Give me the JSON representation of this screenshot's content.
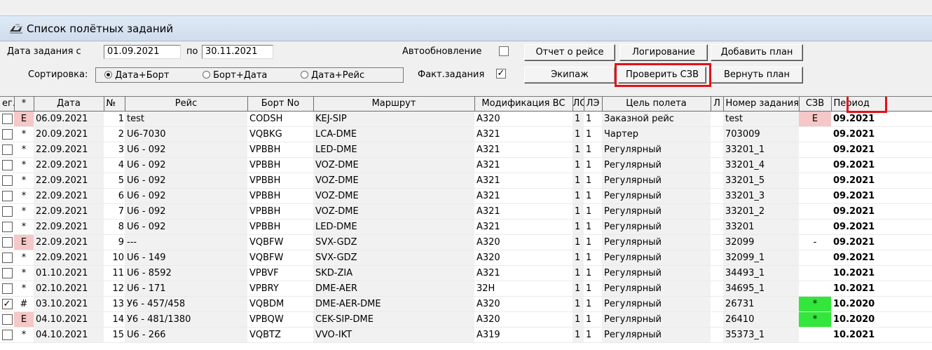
{
  "window": {
    "title": "Список полётных заданий"
  },
  "filters": {
    "date_from_label": "Дата задания с",
    "date_from": "01.09.2021",
    "date_to_label": "по",
    "date_to": "30.11.2021",
    "sort_label": "Сортировка:",
    "sort_options": [
      "Дата+Борт",
      "Борт+Дата",
      "Дата+Рейс"
    ],
    "sort_selected": "Дата+Борт",
    "autoupdate_label": "Автообновление",
    "autoupdate_checked": false,
    "fact_label": "Факт.задания",
    "fact_checked": true,
    "fact_mark": "✓"
  },
  "buttons": {
    "report": "Отчет о рейсе",
    "logging": "Логирование",
    "add_plan": "Добавить план",
    "crew": "Экипаж",
    "check_szv": "Проверить СЗВ",
    "return_plan": "Вернуть план"
  },
  "table": {
    "columns": [
      "ег.",
      "*",
      "Дата",
      "№",
      "Рейс",
      "Борт No",
      "Маршрут",
      "Модификация ВС",
      "ЛО",
      "ЛЭ",
      "Цель полета",
      "Л",
      "Номер задания",
      "СЗВ",
      "Период"
    ],
    "rows": [
      {
        "check": "",
        "mark": "E",
        "date": "06.09.2021",
        "no": "1",
        "flight": "test",
        "board": "CODSH",
        "route": "KEJ-SIP",
        "mod": "A320",
        "lo": "1",
        "le": "1",
        "purpose": "Заказной рейс",
        "l": "",
        "task": "test",
        "szv": "E",
        "period": "09.2021"
      },
      {
        "check": "",
        "mark": "*",
        "date": "20.09.2021",
        "no": "2",
        "flight": "U6-7030",
        "board": "VQBKG",
        "route": "LCA-DME",
        "mod": "A321",
        "lo": "1",
        "le": "1",
        "purpose": "Чартер",
        "l": "",
        "task": "703009",
        "szv": "",
        "period": "09.2021"
      },
      {
        "check": "",
        "mark": "*",
        "date": "22.09.2021",
        "no": "3",
        "flight": "U6 - 092",
        "board": "VPBBH",
        "route": "LED-DME",
        "mod": "A321",
        "lo": "1",
        "le": "1",
        "purpose": "Регулярный",
        "l": "",
        "task": "33201_1",
        "szv": "",
        "period": "09.2021"
      },
      {
        "check": "",
        "mark": "*",
        "date": "22.09.2021",
        "no": "4",
        "flight": "U6 - 092",
        "board": "VPBBH",
        "route": "VOZ-DME",
        "mod": "A321",
        "lo": "1",
        "le": "1",
        "purpose": "Регулярный",
        "l": "",
        "task": "33201_4",
        "szv": "",
        "period": "09.2021"
      },
      {
        "check": "",
        "mark": "*",
        "date": "22.09.2021",
        "no": "5",
        "flight": "U6 - 092",
        "board": "VPBBH",
        "route": "VOZ-DME",
        "mod": "A321",
        "lo": "1",
        "le": "1",
        "purpose": "Регулярный",
        "l": "",
        "task": "33201_5",
        "szv": "",
        "period": "09.2021"
      },
      {
        "check": "",
        "mark": "*",
        "date": "22.09.2021",
        "no": "6",
        "flight": "U6 - 092",
        "board": "VPBBH",
        "route": "VOZ-DME",
        "mod": "A321",
        "lo": "1",
        "le": "1",
        "purpose": "Регулярный",
        "l": "",
        "task": "33201_3",
        "szv": "",
        "period": "09.2021"
      },
      {
        "check": "",
        "mark": "*",
        "date": "22.09.2021",
        "no": "7",
        "flight": "U6 - 092",
        "board": "VPBBH",
        "route": "VOZ-DME",
        "mod": "A321",
        "lo": "1",
        "le": "1",
        "purpose": "Регулярный",
        "l": "",
        "task": "33201_2",
        "szv": "",
        "period": "09.2021"
      },
      {
        "check": "",
        "mark": "*",
        "date": "22.09.2021",
        "no": "8",
        "flight": "U6 - 092",
        "board": "VPBBH",
        "route": "LED-DME",
        "mod": "A321",
        "lo": "1",
        "le": "1",
        "purpose": "Регулярный",
        "l": "",
        "task": "33201",
        "szv": "",
        "period": "09.2021"
      },
      {
        "check": "",
        "mark": "E",
        "date": "22.09.2021",
        "no": "9",
        "flight": "---",
        "board": "VQBFW",
        "route": "SVX-GDZ",
        "mod": "A320",
        "lo": "1",
        "le": "1",
        "purpose": "Регулярный",
        "l": "",
        "task": "32099",
        "szv": "-",
        "period": "09.2021"
      },
      {
        "check": "",
        "mark": "*",
        "date": "22.09.2021",
        "no": "10",
        "flight": "U6 - 149",
        "board": "VQBFW",
        "route": "SVX-GDZ",
        "mod": "A320",
        "lo": "1",
        "le": "1",
        "purpose": "Регулярный",
        "l": "",
        "task": "32099_1",
        "szv": "",
        "period": "09.2021"
      },
      {
        "check": "",
        "mark": "*",
        "date": "01.10.2021",
        "no": "11",
        "flight": "U6 - 8592",
        "board": "VPBVF",
        "route": "SKD-ZIA",
        "mod": "A321",
        "lo": "1",
        "le": "1",
        "purpose": "Регулярный",
        "l": "",
        "task": "34493_1",
        "szv": "",
        "period": "10.2021"
      },
      {
        "check": "",
        "mark": "*",
        "date": "02.10.2021",
        "no": "12",
        "flight": "U6 - 171",
        "board": "VPBRY",
        "route": "DME-AER",
        "mod": "32H",
        "lo": "1",
        "le": "1",
        "purpose": "Регулярный",
        "l": "",
        "task": "34695_1",
        "szv": "",
        "period": "10.2021"
      },
      {
        "check": "✓",
        "mark": "#",
        "date": "03.10.2021",
        "no": "13",
        "flight": "У6 - 457/458",
        "board": "VQBDM",
        "route": "DME-AER-DME",
        "mod": "A320",
        "lo": "1",
        "le": "1",
        "purpose": "Регулярный",
        "l": "",
        "task": "26731",
        "szv": "*",
        "period": "10.2020"
      },
      {
        "check": "",
        "mark": "E",
        "date": "04.10.2021",
        "no": "14",
        "flight": "У6 - 481/1380",
        "board": "VPBQW",
        "route": "CEK-SIP-DME",
        "mod": "A320",
        "lo": "1",
        "le": "1",
        "purpose": "Регулярный",
        "l": "",
        "task": "26410",
        "szv": "*",
        "period": "10.2020"
      },
      {
        "check": "",
        "mark": "*",
        "date": "04.10.2021",
        "no": "15",
        "flight": "U6 - 266",
        "board": "VQBTZ",
        "route": "VVO-IKT",
        "mod": "A319",
        "lo": "1",
        "le": "1",
        "purpose": "Регулярный",
        "l": "",
        "task": "35373_1",
        "szv": "",
        "period": "10.2021"
      }
    ]
  },
  "colors": {
    "szv_error": "#f5c7c7",
    "szv_ok": "#32e63c",
    "highlight": "#e3101a",
    "mark_error": "#f5c7c7"
  }
}
